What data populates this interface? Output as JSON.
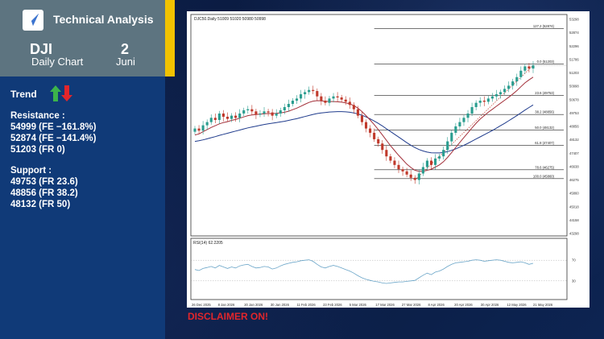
{
  "header": {
    "brand": "Technical Analysis",
    "ticker": "DJI",
    "chart_kind": "Daily Chart",
    "day": "2",
    "month": "Juni"
  },
  "sidebar": {
    "trend_label": "Trend",
    "resistance_title": "Resistance :",
    "resistance": [
      "54999 (FE −161.8%)",
      "52874 (FE −141.4%)",
      "51203 (FR 0)"
    ],
    "support_title": "Support :",
    "support": [
      "49753 (FR 23.6)",
      "48856 (FR 38.2)",
      "48132 (FR 50)"
    ]
  },
  "disclaimer": "DISCLAIMER ON!",
  "colors": {
    "panel": "#103a78",
    "header": "#5d7480",
    "accent": "#f2c200",
    "up": "#2a9d8f",
    "down": "#c0392b",
    "trend_up": "#3cb44b",
    "trend_down": "#e3262b",
    "disclaimer": "#e3262b"
  },
  "chart_data": {
    "type": "line",
    "title": "DJC50.Daily 51009 51020 50980 50998",
    "price_axis": [
      "53298",
      "52874",
      "52296",
      "51786",
      "51203",
      "50998",
      "50678",
      "49753",
      "48856",
      "48132",
      "47407",
      "46638",
      "46275",
      "45860",
      "45018",
      "44158",
      "43298"
    ],
    "fib_levels": [
      {
        "label": "127.2 (52874)",
        "value": 52874
      },
      {
        "label": "0.0 (51203)",
        "value": 51203
      },
      {
        "label": "23.6 (49753)",
        "value": 49753
      },
      {
        "label": "38.2 (48856)",
        "value": 48856
      },
      {
        "label": "50.0 (48132)",
        "value": 48132
      },
      {
        "label": "61.8 (47407)",
        "value": 47407
      },
      {
        "label": "78.6 (46275)",
        "value": 46275
      },
      {
        "label": "100.0 (45860)",
        "value": 45860
      }
    ],
    "dates": [
      "26 Dec 2025",
      "8 Jan 2026",
      "20 Jan 2026",
      "30 Jan 2026",
      "11 Feb 2026",
      "23 Feb 2026",
      "5 Mar 2026",
      "17 Mar 2026",
      "27 Mar 2026",
      "8 Apr 2026",
      "20 Apr 2026",
      "30 Apr 2026",
      "12 May 2026",
      "21 May 2026"
    ],
    "close": [
      48200,
      48100,
      48350,
      48500,
      48700,
      48600,
      48900,
      48750,
      48650,
      48800,
      48700,
      48900,
      49050,
      49100,
      49000,
      48850,
      48900,
      49000,
      48950,
      48800,
      48900,
      49050,
      49200,
      49350,
      49500,
      49600,
      49800,
      49900,
      50000,
      49950,
      49700,
      49500,
      49400,
      49600,
      49700,
      49650,
      49550,
      49450,
      49300,
      49100,
      48800,
      48500,
      48200,
      48000,
      47700,
      47500,
      47200,
      46900,
      46700,
      46500,
      46300,
      46200,
      46050,
      45900,
      45800,
      46100,
      46400,
      46700,
      46500,
      46800,
      46900,
      47200,
      47600,
      48000,
      48300,
      48500,
      48700,
      48900,
      49200,
      49400,
      49500,
      49450,
      49600,
      49700,
      49800,
      49900,
      50050,
      50200,
      50400,
      50600,
      50900,
      51100,
      51000,
      51150
    ],
    "ma_fast": [
      47900,
      47950,
      48050,
      48150,
      48250,
      48330,
      48420,
      48480,
      48520,
      48580,
      48620,
      48680,
      48740,
      48800,
      48830,
      48850,
      48870,
      48890,
      48900,
      48900,
      48910,
      48930,
      48960,
      49010,
      49080,
      49150,
      49240,
      49330,
      49420,
      49480,
      49500,
      49490,
      49470,
      49460,
      49460,
      49450,
      49430,
      49400,
      49350,
      49270,
      49150,
      48990,
      48800,
      48600,
      48380,
      48150,
      47900,
      47650,
      47400,
      47170,
      46950,
      46740,
      46540,
      46380,
      46250,
      46200,
      46200,
      46250,
      46300,
      46400,
      46500,
      46650,
      46850,
      47080,
      47320,
      47550,
      47780,
      48000,
      48230,
      48450,
      48640,
      48800,
      48960,
      49100,
      49240,
      49380,
      49520,
      49660,
      49810,
      49970,
      50150,
      50330,
      50470,
      50600
    ],
    "ma_slow": [
      47600,
      47630,
      47670,
      47720,
      47770,
      47820,
      47880,
      47930,
      47980,
      48030,
      48080,
      48130,
      48180,
      48230,
      48270,
      48310,
      48350,
      48390,
      48420,
      48450,
      48480,
      48510,
      48540,
      48580,
      48620,
      48660,
      48710,
      48760,
      48810,
      48860,
      48900,
      48930,
      48950,
      48970,
      48980,
      48990,
      48990,
      48980,
      48960,
      48930,
      48880,
      48820,
      48740,
      48650,
      48550,
      48440,
      48320,
      48190,
      48060,
      47930,
      47800,
      47670,
      47540,
      47420,
      47310,
      47220,
      47150,
      47100,
      47070,
      47060,
      47060,
      47080,
      47120,
      47180,
      47250,
      47330,
      47420,
      47510,
      47610,
      47710,
      47810,
      47910,
      48010,
      48110,
      48220,
      48330,
      48440,
      48560,
      48680,
      48800,
      48930,
      49060,
      49180,
      49300
    ],
    "rsi_label": "RSI(14) 62.2205",
    "rsi_levels": [
      70,
      30
    ],
    "rsi": [
      52,
      50,
      54,
      56,
      58,
      55,
      60,
      57,
      54,
      57,
      55,
      59,
      61,
      62,
      58,
      55,
      56,
      58,
      57,
      53,
      55,
      59,
      62,
      64,
      66,
      67,
      69,
      70,
      71,
      68,
      62,
      57,
      55,
      58,
      60,
      58,
      55,
      52,
      49,
      45,
      40,
      36,
      33,
      31,
      29,
      28,
      26,
      25,
      26,
      27,
      28,
      28,
      29,
      30,
      31,
      36,
      41,
      45,
      42,
      47,
      49,
      53,
      58,
      62,
      65,
      66,
      67,
      68,
      70,
      71,
      70,
      68,
      69,
      70,
      71,
      70,
      68,
      66,
      65,
      66,
      67,
      65,
      62,
      64
    ],
    "ylim": [
      43298,
      53298
    ],
    "rsi_ylim": [
      0,
      100
    ]
  }
}
